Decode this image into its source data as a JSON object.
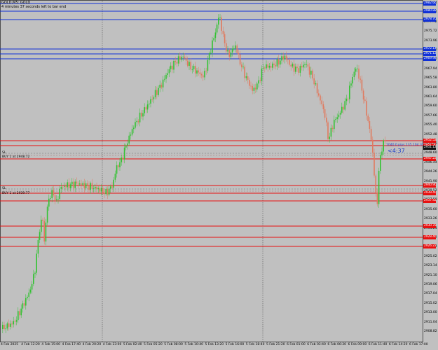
{
  "header": {
    "symbol_line": "GOLD,M5: GOLD",
    "countdown_line": "4 minutes 37 seconds left to bar end"
  },
  "price_axis_labels": [
    "2981.94",
    "2979.72",
    "2977.72",
    "2975.72",
    "2973.96",
    "2971.70",
    "2969.80",
    "2967.94",
    "2965.58",
    "2963.80",
    "2961.64",
    "2959.60",
    "2957.66",
    "2955.40",
    "2952.48",
    "2950.46",
    "2948.60",
    "2946.44",
    "2944.26",
    "2941.90",
    "2939.52",
    "2937.58",
    "2935.60",
    "2933.26",
    "2931.24",
    "2929.22",
    "2927.04",
    "2925.02",
    "2923.14",
    "2921.10",
    "2919.06",
    "2917.04",
    "2915.02",
    "2913.00",
    "2911.04",
    "2908.82"
  ],
  "time_axis_labels": [
    "4 Feb 2025",
    "4 Feb 12:20",
    "4 Feb 15:00",
    "4 Feb 17:40",
    "4 Feb 20:20",
    "4 Feb 23:00",
    "5 Feb 02:40",
    "5 Feb 05:20",
    "5 Feb 08:00",
    "5 Feb 10:40",
    "5 Feb 13:20",
    "5 Feb 16:00",
    "5 Feb 18:40",
    "5 Feb 21:20",
    "6 Feb 01:00",
    "6 Feb 03:40",
    "6 Feb 06:20",
    "6 Feb 09:00",
    "6 Feb 11:40",
    "6 Feb 14:20",
    "6 Feb 17:00"
  ],
  "horizontal_lines": [
    {
      "color": "#1030d8",
      "price_tag": "2982.66"
    },
    {
      "color": "#1030d8",
      "price_tag": "2980.88"
    },
    {
      "color": "#1030d8",
      "price_tag": "2978.70"
    },
    {
      "color": "#1030d8",
      "price_tag": "2972.14"
    },
    {
      "color": "#1030d8",
      "price_tag": "2971.12"
    },
    {
      "color": "#1030d8",
      "price_tag": "2969.98"
    },
    {
      "color": "#e81010",
      "price_tag": "2952.52"
    },
    {
      "color": "#e81010",
      "price_tag": "2951.56"
    },
    {
      "color": "#e81010",
      "price_tag": "2947.22"
    },
    {
      "color": "#e81010",
      "price_tag": "2940.90"
    },
    {
      "color": "#e81010",
      "price_tag": "2939.40"
    },
    {
      "color": "#e81010",
      "price_tag": "2937.42"
    },
    {
      "color": "#e81010",
      "price_tag": "2930.78"
    },
    {
      "color": "#e81010",
      "price_tag": "2928.46"
    },
    {
      "color": "#e81010",
      "price_tag": "2926.22"
    }
  ],
  "order_lines": [
    {
      "label_top": "SL",
      "label_bottom": "BUY 1 at 2948.72"
    },
    {
      "label_top": "SL",
      "label_bottom": "BUY 1 at 2939.77"
    }
  ],
  "current_price_tag": "2951.12",
  "trade_info": "1040.0 pips 135.104.37",
  "countdown_overlay": "<4:37",
  "colors": {
    "background": "#c0c0c0",
    "bull_candle": "#33c233",
    "bear_candle": "#e07a5f",
    "resistance_line": "#1030d8",
    "support_line": "#e81010",
    "grid_separator": "#404040"
  }
}
